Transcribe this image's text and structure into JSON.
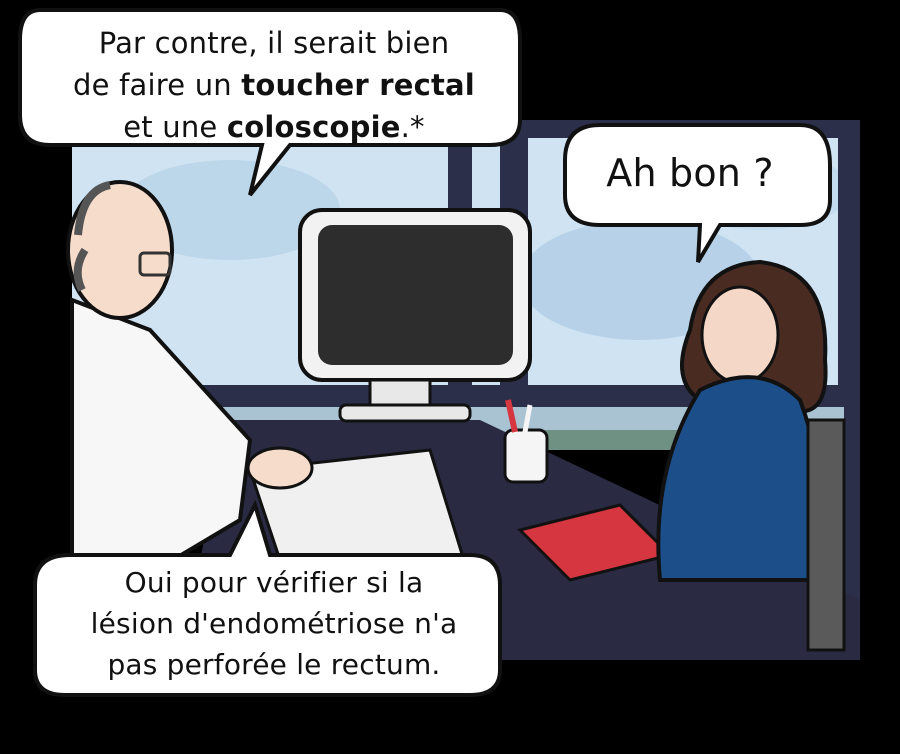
{
  "speech_bubbles": {
    "doctor_top": {
      "line1": "Par contre, il serait bien",
      "line2_prefix": "de faire un ",
      "line2_bold": "toucher rectal",
      "line3_prefix": "et une ",
      "line3_bold": "coloscopie",
      "line3_suffix": ".*"
    },
    "patient": {
      "text": "Ah bon ?"
    },
    "doctor_bottom": {
      "line1": "Oui pour vérifier si la",
      "line2": "lésion d'endométriose n'a",
      "line3": "pas perforée le rectum."
    }
  },
  "colors": {
    "background": "#000000",
    "window_sky": "#cfe3f2",
    "window_frame": "#2b2f4a",
    "desk": "#2a2b42",
    "monitor_body": "#f2f2f2",
    "monitor_screen": "#2d2d2d",
    "doctor_coat": "#f7f7f7",
    "doctor_skin": "#f6dccb",
    "patient_sweater": "#1c4f8a",
    "patient_hair": "#4a2b22",
    "book_red": "#d6363f",
    "bubble_fill": "#ffffff"
  }
}
